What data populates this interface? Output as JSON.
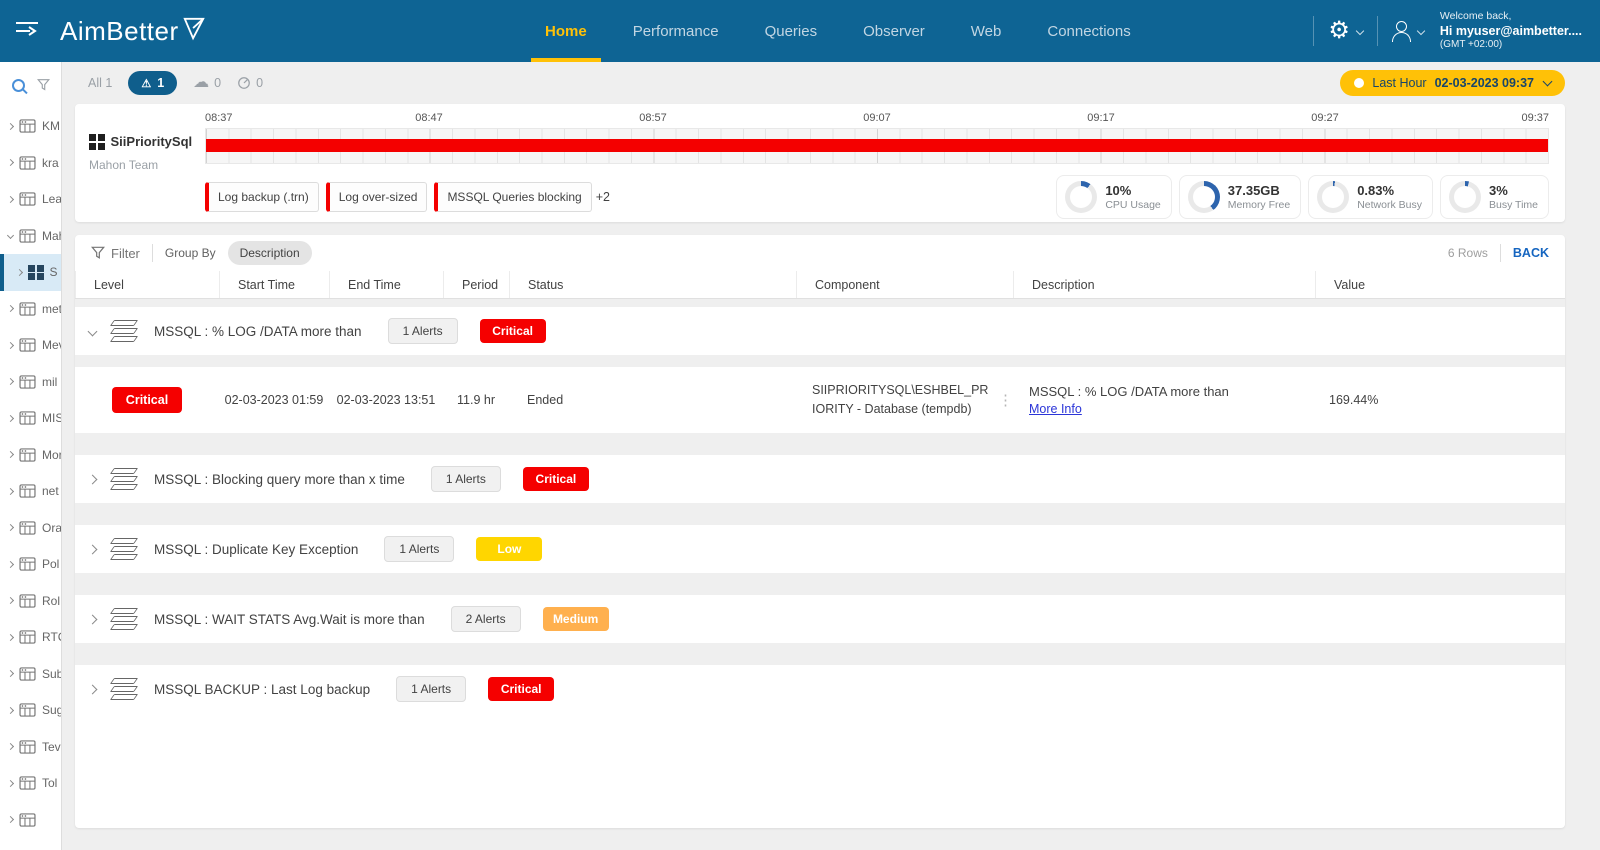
{
  "header": {
    "logo": "AimBetter",
    "nav": [
      {
        "label": "Home",
        "active": true
      },
      {
        "label": "Performance",
        "active": false
      },
      {
        "label": "Queries",
        "active": false
      },
      {
        "label": "Observer",
        "active": false
      },
      {
        "label": "Web",
        "active": false
      },
      {
        "label": "Connections",
        "active": false
      }
    ],
    "user": {
      "welcome": "Welcome back,",
      "name": "Hi myuser@aimbetter....",
      "timezone": "(GMT +02:00)"
    }
  },
  "sidebar": {
    "items": [
      {
        "label": "KMI"
      },
      {
        "label": "kra"
      },
      {
        "label": "Lea"
      },
      {
        "label": "Mah",
        "expanded": true
      },
      {
        "label": "S",
        "selected": true,
        "child": true,
        "windows": true
      },
      {
        "label": "met"
      },
      {
        "label": "Mev"
      },
      {
        "label": "mil"
      },
      {
        "label": "MIS"
      },
      {
        "label": "Mor"
      },
      {
        "label": "net"
      },
      {
        "label": "Ora"
      },
      {
        "label": "Pol"
      },
      {
        "label": "Rol"
      },
      {
        "label": "RTC"
      },
      {
        "label": "Sub"
      },
      {
        "label": "Sug"
      },
      {
        "label": "Tev"
      },
      {
        "label": "Tol"
      },
      {
        "label": ""
      }
    ]
  },
  "filters": {
    "all_label": "All 1",
    "alert_count": "1",
    "cloud_count": "0",
    "gauge_count": "0",
    "time_range_label": "Last Hour",
    "time_range_value": "02-03-2023 09:37"
  },
  "server_panel": {
    "server_name": "SiiPrioritySql",
    "team": "Mahon Team",
    "timeline_labels": [
      "08:37",
      "08:47",
      "08:57",
      "09:07",
      "09:17",
      "09:27",
      "09:37"
    ],
    "tags": [
      "Log backup (.trn)",
      "Log over-sized",
      "MSSQL Queries blocking"
    ],
    "tags_more": "+2",
    "gauges": [
      {
        "value": "10%",
        "label": "CPU Usage",
        "pct": 10
      },
      {
        "value": "37.35GB",
        "label": "Memory Free",
        "pct": 40
      },
      {
        "value": "0.83%",
        "label": "Network Busy",
        "pct": 2
      },
      {
        "value": "3%",
        "label": "Busy Time",
        "pct": 4
      }
    ],
    "gauge_color": "#2d64ad"
  },
  "table": {
    "toolbar": {
      "filter_label": "Filter",
      "group_by_label": "Group By",
      "group_by_value": "Description",
      "rows_count": "6 Rows",
      "back_label": "BACK"
    },
    "columns": [
      "Level",
      "Start Time",
      "End Time",
      "Period",
      "Status",
      "Component",
      "Description",
      "Value"
    ],
    "rows": [
      {
        "type": "group",
        "expanded": true,
        "title": "MSSQL : % LOG /DATA more than",
        "alerts": "1 Alerts",
        "severity": "Critical",
        "severity_color": "#f50000"
      },
      {
        "type": "detail",
        "level": "Critical",
        "level_color": "#f50000",
        "start": "02-03-2023 01:59",
        "end": "02-03-2023 13:51",
        "period": "11.9 hr",
        "status": "Ended",
        "component": "SIIPRIORITYSQL\\ESHBEL_PRIORITY - Database (tempdb)",
        "description": "MSSQL : % LOG /DATA more than",
        "more_info": "More Info",
        "value": "169.44%"
      },
      {
        "type": "group",
        "expanded": false,
        "title": "MSSQL : Blocking query more than x time",
        "alerts": "1 Alerts",
        "severity": "Critical",
        "severity_color": "#f50000"
      },
      {
        "type": "group",
        "expanded": false,
        "title": "MSSQL : Duplicate Key Exception",
        "alerts": "1 Alerts",
        "severity": "Low",
        "severity_color": "#ffd600"
      },
      {
        "type": "group",
        "expanded": false,
        "title": "MSSQL : WAIT STATS Avg.Wait is more than",
        "alerts": "2 Alerts",
        "severity": "Medium",
        "severity_color": "#ffb04e"
      },
      {
        "type": "group",
        "expanded": false,
        "title": "MSSQL BACKUP : Last Log backup",
        "alerts": "1 Alerts",
        "severity": "Critical",
        "severity_color": "#f50000"
      }
    ]
  }
}
